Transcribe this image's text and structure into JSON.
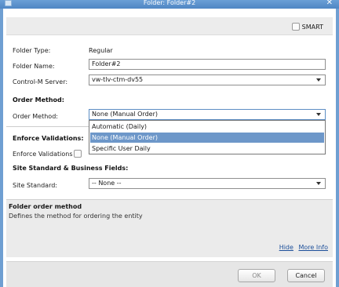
{
  "window": {
    "title": "Folder: Folder#2"
  },
  "smart": {
    "label": "SMART",
    "checked": false
  },
  "fields": {
    "folder_type_label": "Folder Type:",
    "folder_type_value": "Regular",
    "folder_name_label": "Folder Name:",
    "folder_name_value": "Folder#2",
    "server_label": "Control-M Server:",
    "server_value": "vw-tlv-ctm-dv55"
  },
  "order_method_section": {
    "title": "Order Method:",
    "label": "Order Method:",
    "value": "None (Manual Order)",
    "options": [
      "Automatic (Daily)",
      "None (Manual Order)",
      "Specific User Daily"
    ],
    "selected_index": 1
  },
  "enforce_section": {
    "title": "Enforce Validations:",
    "checkbox_label": "Enforce Validations"
  },
  "site_section": {
    "title": "Site Standard & Business Fields:",
    "site_label": "Site Standard:",
    "site_value": "-- None --"
  },
  "help": {
    "title": "Folder order method",
    "description": "Defines the method for ordering the entity",
    "hide_link": "Hide",
    "more_info_link": "More Info"
  },
  "buttons": {
    "ok": "OK",
    "cancel": "Cancel"
  }
}
